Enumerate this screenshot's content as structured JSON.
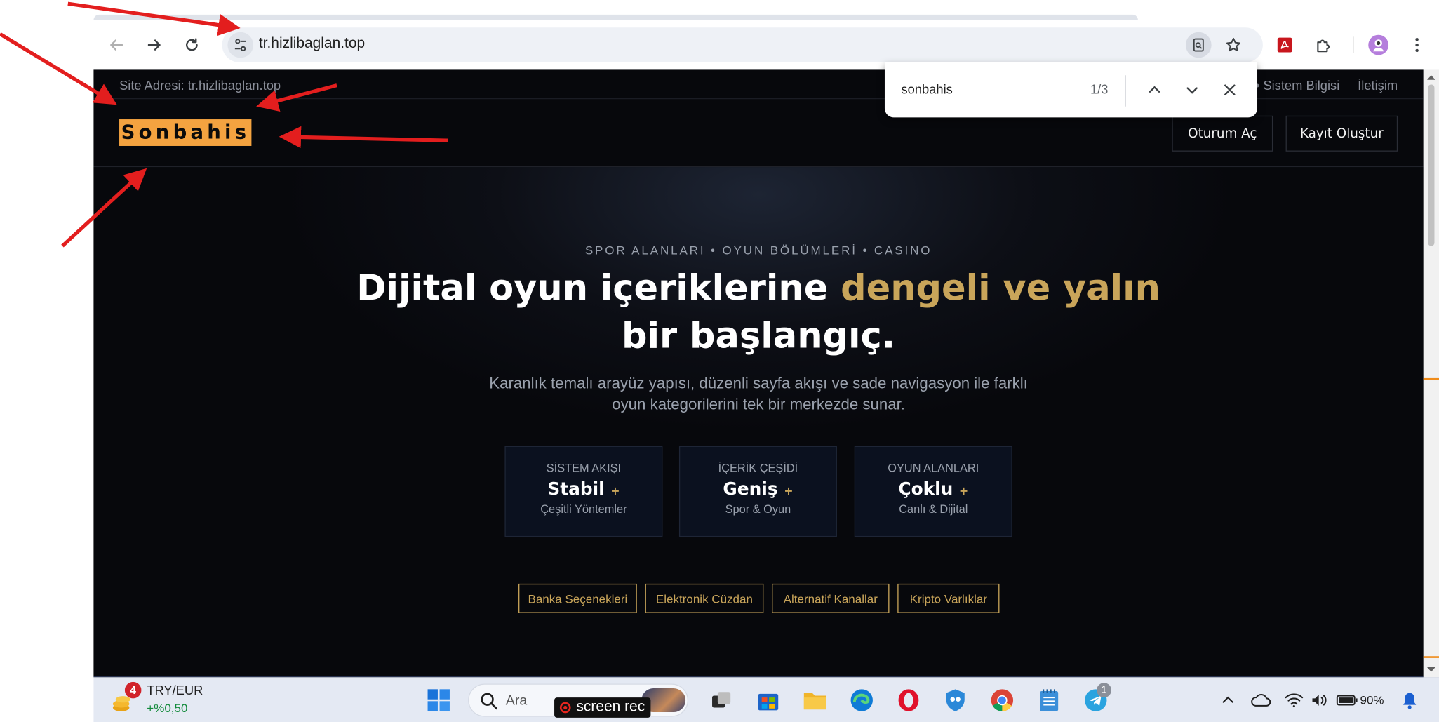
{
  "browser": {
    "url": "tr.hizlibaglan.top"
  },
  "find_bar": {
    "query": "sonbahis",
    "match_count": "1/3"
  },
  "site": {
    "address_label": "Site Adresi: tr.hizlibaglan.top",
    "top_links_partial": "L • Sistem Bilgisi",
    "contact_link": "İletişim",
    "logo": "Sonbahis",
    "login_button": "Oturum Aç",
    "register_button": "Kayıt Oluştur",
    "kicker": "SPOR ALANLARI • OYUN BÖLÜMLERİ • CASINO",
    "headline_part1": "Dijital oyun içeriklerine ",
    "headline_accent": "dengeli ve yalın",
    "headline_part2": "bir başlangıç.",
    "lead_line1": "Karanlık temalı arayüz yapısı, düzenli sayfa akışı ve sade navigasyon ile farklı",
    "lead_line2": "oyun kategorilerini tek bir merkezde sunar.",
    "stats": [
      {
        "label": "SİSTEM AKIŞI",
        "value": "Stabil",
        "plus": "+",
        "sub": "Çeşitli Yöntemler"
      },
      {
        "label": "İÇERİK ÇEŞİDİ",
        "value": "Geniş",
        "plus": "+",
        "sub": "Spor & Oyun"
      },
      {
        "label": "OYUN ALANLARI",
        "value": "Çoklu",
        "plus": "+",
        "sub": "Canlı & Dijital"
      }
    ],
    "chips": [
      "Banka Seçenekleri",
      "Elektronik Cüzdan",
      "Alternatif Kanallar",
      "Kripto Varlıklar"
    ]
  },
  "taskbar": {
    "ticker_pair": "TRY/EUR",
    "ticker_change": "+%0,50",
    "notification_count": "4",
    "search_placeholder": "Ara",
    "screenrec_label": "screen rec",
    "telegram_badge": "1",
    "battery": "90%"
  },
  "colors": {
    "page_bg": "#07080c",
    "accent_gold": "#c9a55a",
    "logo_highlight": "#f4a340",
    "annotation_red": "#e31e1e"
  }
}
